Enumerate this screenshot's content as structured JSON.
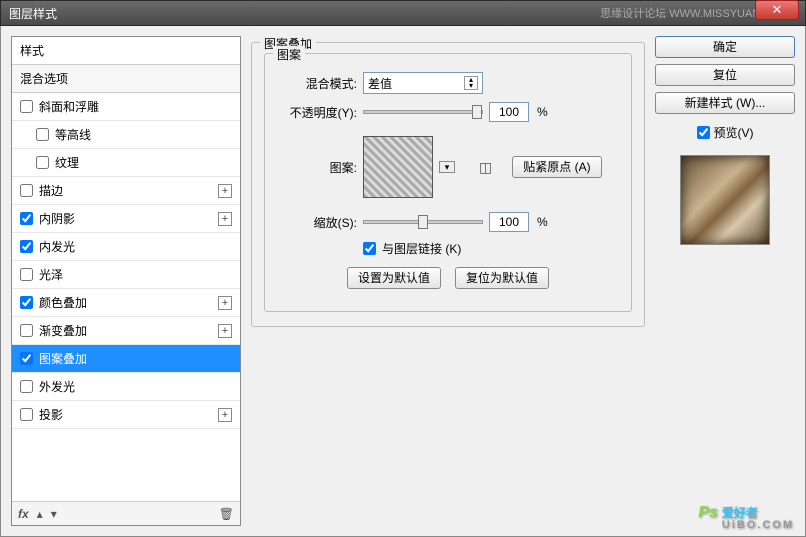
{
  "window": {
    "title": "图层样式",
    "rightText": "思缘设计论坛  WWW.MISSYUAN.COM"
  },
  "sidebar": {
    "header": "样式",
    "blending": "混合选项",
    "items": [
      {
        "label": "斜面和浮雕",
        "checked": false,
        "hasPlus": false
      },
      {
        "label": "等高线",
        "checked": false,
        "sub": true
      },
      {
        "label": "纹理",
        "checked": false,
        "sub": true
      },
      {
        "label": "描边",
        "checked": false,
        "hasPlus": true
      },
      {
        "label": "内阴影",
        "checked": true,
        "hasPlus": true
      },
      {
        "label": "内发光",
        "checked": true,
        "hasPlus": false
      },
      {
        "label": "光泽",
        "checked": false,
        "hasPlus": false
      },
      {
        "label": "颜色叠加",
        "checked": true,
        "hasPlus": true
      },
      {
        "label": "渐变叠加",
        "checked": false,
        "hasPlus": true
      },
      {
        "label": "图案叠加",
        "checked": true,
        "selected": true
      },
      {
        "label": "外发光",
        "checked": false,
        "hasPlus": false
      },
      {
        "label": "投影",
        "checked": false,
        "hasPlus": true
      }
    ],
    "footer": {
      "fx": "fx"
    }
  },
  "panel": {
    "title": "图案叠加",
    "innerTitle": "图案",
    "blendMode": {
      "label": "混合模式:",
      "value": "差值"
    },
    "opacity": {
      "label": "不透明度(Y):",
      "value": "100",
      "unit": "%"
    },
    "patternLabel": "图案:",
    "snapOrigin": "贴紧原点 (A)",
    "scale": {
      "label": "缩放(S):",
      "value": "100",
      "unit": "%"
    },
    "linkLayer": "与图层链接 (K)",
    "setDefault": "设置为默认值",
    "resetDefault": "复位为默认值"
  },
  "actions": {
    "ok": "确定",
    "reset": "复位",
    "newStyle": "新建样式 (W)...",
    "preview": "预览(V)"
  },
  "watermark": {
    "ps": "Ps",
    "main": "爱好者",
    "sub": "UiBO.COM"
  }
}
